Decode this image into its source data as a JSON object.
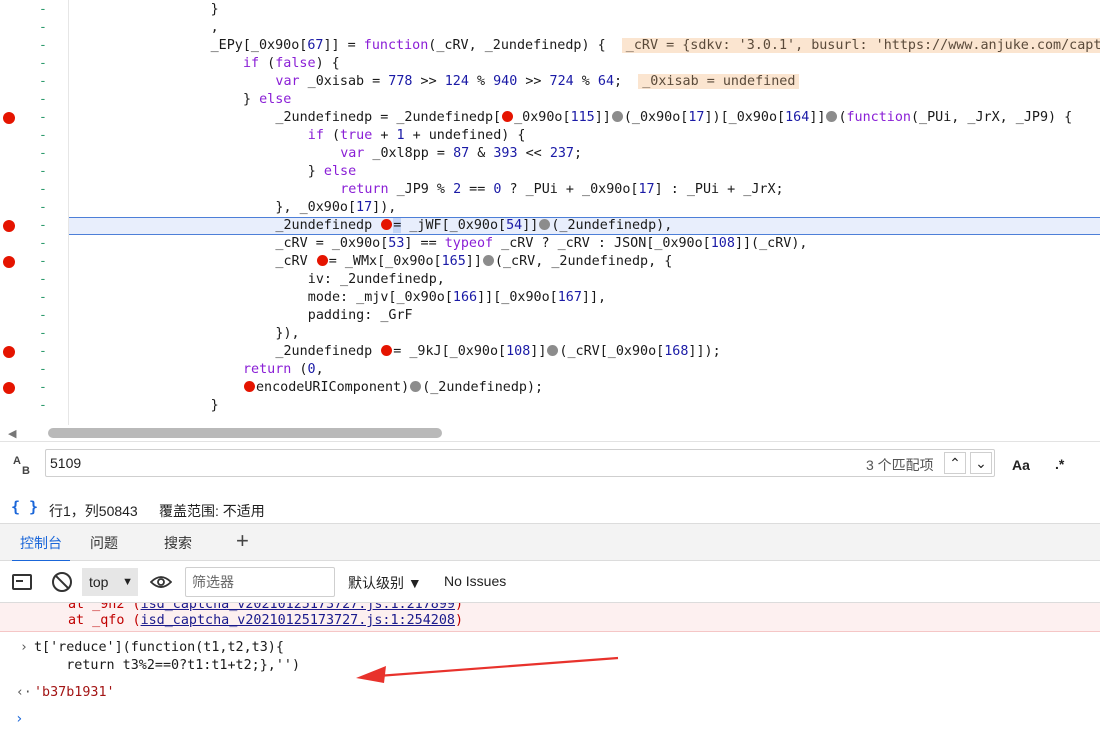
{
  "code_lines": [
    {
      "bp": false,
      "indent": 26,
      "html": "}"
    },
    {
      "bp": false,
      "indent": 26,
      "html": ","
    },
    {
      "bp": false,
      "indent": 26,
      "html": "_EPy[_0x90o[<span class=\"num\">67</span>]] = <span class=\"kw\">function</span>(_cRV, _2undefinedp) {  <span class=\"inline-val\">_cRV = {sdkv: '3.0.1', busurl: 'https://www.anjuke.com/captcha</span>"
    },
    {
      "bp": false,
      "indent": 30,
      "html": "<span class=\"kw\">if</span> (<span class=\"kw\">false</span>) {"
    },
    {
      "bp": false,
      "indent": 34,
      "html": "<span class=\"kw\">var</span> _0xisab = <span class=\"num\">778</span> >> <span class=\"num\">124</span> % <span class=\"num\">940</span> >> <span class=\"num\">724</span> % <span class=\"num\">64</span>;  <span class=\"inline-val\">_0xisab = undefined</span>"
    },
    {
      "bp": false,
      "indent": 30,
      "html": "} <span class=\"kw\">else</span>"
    },
    {
      "bp": true,
      "indent": 34,
      "html": "_2undefinedp = _2undefinedp[<span class=\"dot-red\"></span>_0x90o[<span class=\"num\">115</span>]]<span class=\"dot-gray\"></span>(_0x90o[<span class=\"num\">17</span>])[_0x90o[<span class=\"num\">164</span>]]<span class=\"dot-gray\"></span>(<span class=\"kw\">function</span>(_PUi, _JrX, _JP9) {"
    },
    {
      "bp": false,
      "indent": 38,
      "html": "<span class=\"kw\">if</span> (<span class=\"kw\">true</span> + <span class=\"num\">1</span> + undefined) {"
    },
    {
      "bp": false,
      "indent": 42,
      "html": "<span class=\"kw\">var</span> _0xl8pp = <span class=\"num\">87</span> & <span class=\"num\">393</span> << <span class=\"num\">237</span>;"
    },
    {
      "bp": false,
      "indent": 38,
      "html": "} <span class=\"kw\">else</span>"
    },
    {
      "bp": false,
      "indent": 42,
      "html": "<span class=\"kw\">return</span> _JP9 % <span class=\"num\">2</span> == <span class=\"num\">0</span> ? _PUi + _0x90o[<span class=\"num\">17</span>] : _PUi + _JrX;"
    },
    {
      "bp": false,
      "indent": 34,
      "html": "}, _0x90o[<span class=\"num\">17</span>]),"
    },
    {
      "bp": true,
      "indent": 34,
      "hl": true,
      "html": "_2undefinedp <span class=\"dot-red\"></span><span class=\"sel-op\">=</span> _jWF[_0x90o[<span class=\"num\">54</span>]]<span class=\"dot-gray\"></span>(_2undefinedp),"
    },
    {
      "bp": false,
      "indent": 34,
      "html": "_cRV = _0x90o[<span class=\"num\">53</span>] == <span class=\"kw\">typeof</span> _cRV ? _cRV : JSON[_0x90o[<span class=\"num\">108</span>]](_cRV),"
    },
    {
      "bp": true,
      "indent": 34,
      "html": "_cRV <span class=\"dot-red\"></span>= _WMx[_0x90o[<span class=\"num\">165</span>]]<span class=\"dot-gray\"></span>(_cRV, _2undefinedp, {"
    },
    {
      "bp": false,
      "indent": 38,
      "html": "iv: _2undefinedp,"
    },
    {
      "bp": false,
      "indent": 38,
      "html": "mode: _mjv[_0x90o[<span class=\"num\">166</span>]][_0x90o[<span class=\"num\">167</span>]],"
    },
    {
      "bp": false,
      "indent": 38,
      "html": "padding: _GrF"
    },
    {
      "bp": false,
      "indent": 34,
      "html": "}),"
    },
    {
      "bp": true,
      "indent": 34,
      "html": "_2undefinedp <span class=\"dot-red\"></span>= _9kJ[_0x90o[<span class=\"num\">108</span>]]<span class=\"dot-gray\"></span>(_cRV[_0x90o[<span class=\"num\">168</span>]]);"
    },
    {
      "bp": false,
      "indent": 30,
      "html": "<span class=\"kw\">return</span> (<span class=\"num\">0</span>,"
    },
    {
      "bp": true,
      "indent": 30,
      "html": "<span class=\"dot-red\"></span>encodeURIComponent)<span class=\"dot-gray\"></span>(_2undefinedp);"
    },
    {
      "bp": false,
      "indent": 26,
      "html": "}"
    }
  ],
  "gutter_dash": "-",
  "search": {
    "value": "5109",
    "matches": "3 个匹配项",
    "up": "⌃",
    "down": "⌄",
    "match_case": "Aa",
    "regex": ".*",
    "ab_icon_top": "A",
    "ab_icon_bottom": "B"
  },
  "status": {
    "braces": "{ }",
    "position": "行1，列50843",
    "coverage": "覆盖范围: 不适用"
  },
  "tabs": [
    {
      "label": "控制台",
      "active": true
    },
    {
      "label": "问题",
      "active": false
    },
    {
      "label": "搜索",
      "active": false
    }
  ],
  "tab_add": "+",
  "console_toolbar": {
    "context": "top",
    "caret": "▼",
    "filter_placeholder": "筛选器",
    "levels": "默认级别 ▼",
    "issues": "No Issues"
  },
  "console": {
    "err_line1_pre": "at _9h2 (",
    "err_line1_link": "isd_captcha_v20210125173727.js:1:217899",
    "err_line1_post": ")",
    "err_line2_pre": "at _qfo (",
    "err_line2_link": "isd_captcha_v20210125173727.js:1:254208",
    "err_line2_post": ")",
    "input_prompt": "›",
    "input_line1": "t['reduce'](function(t1,t2,t3){",
    "input_line2": "    return t3%2==0?t1:t1+t2;},'')",
    "result_prompt": "‹·",
    "result": "'b37b1931'",
    "next_prompt": "›"
  }
}
